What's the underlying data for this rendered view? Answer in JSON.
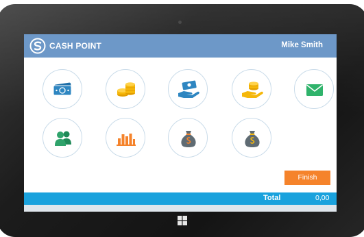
{
  "app": {
    "title": "CASH POINT",
    "user_name": "Mike Smith"
  },
  "tiles": [
    {
      "icon": "banknotes-icon",
      "color": "#2e86c1"
    },
    {
      "icon": "coins-stack-icon",
      "color": "#f5b70a"
    },
    {
      "icon": "cash-in-hand-icon",
      "color": "#2e86c1"
    },
    {
      "icon": "coins-in-hand-icon",
      "color": "#f5b70a"
    },
    {
      "icon": "envelope-icon",
      "color": "#2fb36b"
    },
    {
      "icon": "users-icon",
      "color": "#2fa36b"
    },
    {
      "icon": "bar-chart-icon",
      "color": "#f5832b"
    },
    {
      "icon": "money-bag-icon",
      "color": "#5f6b73"
    },
    {
      "icon": "money-bag-icon",
      "color": "#5f6b73"
    }
  ],
  "actions": {
    "finish_label": "Finish"
  },
  "footer": {
    "total_label": "Total",
    "total_value": "0,00"
  },
  "colors": {
    "header": "#6d98c8",
    "accent_blue": "#1aa2dd",
    "finish_orange": "#f5832b",
    "tile_border": "#c9dbe9"
  }
}
